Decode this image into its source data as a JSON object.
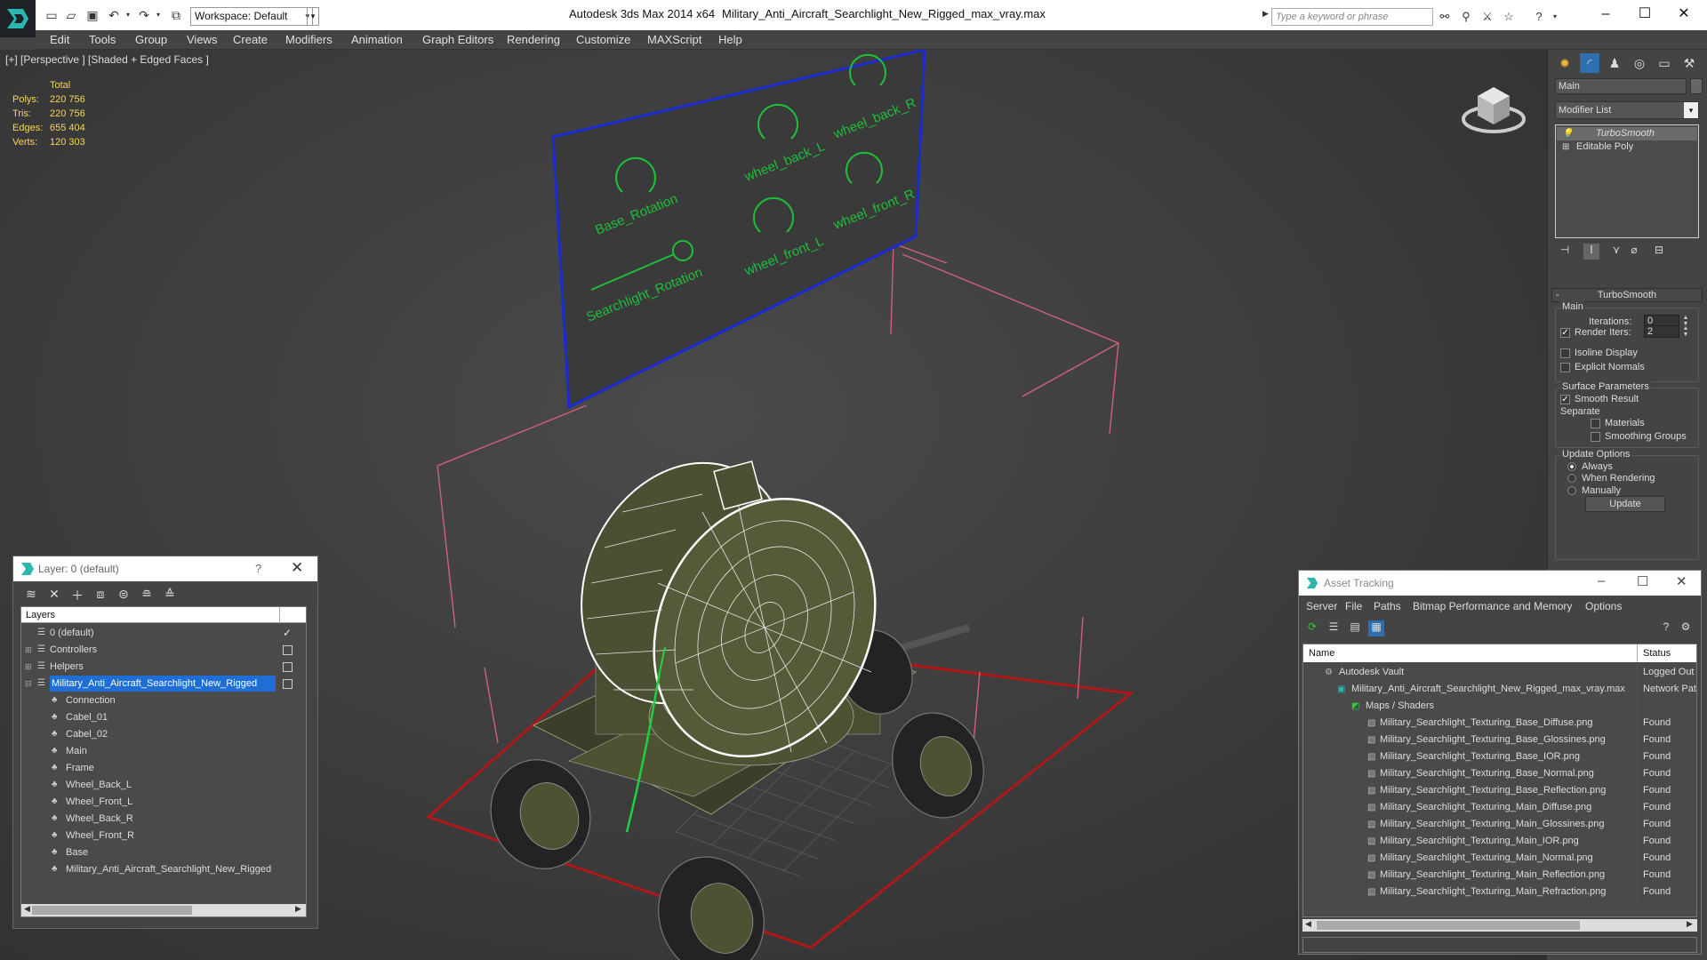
{
  "titlebar": {
    "workspace": "Workspace: Default",
    "app_title": "Autodesk 3ds Max  2014 x64",
    "doc_title": "Military_Anti_Aircraft_Searchlight_New_Rigged_max_vray.max",
    "search_placeholder": "Type a keyword or phrase"
  },
  "menu": [
    "Edit",
    "Tools",
    "Group",
    "Views",
    "Create",
    "Modifiers",
    "Animation",
    "Graph Editors",
    "Rendering",
    "Customize",
    "MAXScript",
    "Help"
  ],
  "viewport": {
    "label": "[+] [Perspective ] [Shaded + Edged Faces ]",
    "stats": {
      "total_label": "Total",
      "polys_label": "Polys:",
      "polys": "220 756",
      "tris_label": "Tris:",
      "tris": "220 756",
      "edges_label": "Edges:",
      "edges": "655 404",
      "verts_label": "Verts:",
      "verts": "120 303"
    },
    "board_labels": [
      "Base_Rotation",
      "wheel_back_L",
      "wheel_back_R",
      "wheel_front_L",
      "wheel_front_R",
      "Searchlight_Rotation"
    ]
  },
  "command_panel": {
    "object_name": "Main",
    "modifier_list": "Modifier List",
    "stack": [
      "TurboSmooth",
      "Editable Poly"
    ],
    "rollout_title": "TurboSmooth",
    "main_group": "Main",
    "iterations_label": "Iterations:",
    "iterations": "0",
    "render_iters_label": "Render Iters:",
    "render_iters": "2",
    "isoline": "Isoline Display",
    "explicit_normals": "Explicit Normals",
    "surface_group": "Surface Parameters",
    "smooth_result": "Smooth Result",
    "separate": "Separate",
    "materials": "Materials",
    "smoothing_groups": "Smoothing Groups",
    "update_group": "Update Options",
    "always": "Always",
    "when_rendering": "When Rendering",
    "manually": "Manually",
    "update_btn": "Update"
  },
  "layer_window": {
    "title": "Layer: 0 (default)",
    "help": "?",
    "header": "Layers",
    "layers": [
      "0 (default)",
      "Controllers",
      "Helpers",
      "Military_Anti_Aircraft_Searchlight_New_Rigged"
    ],
    "children": [
      "Connection",
      "Cabel_01",
      "Cabel_02",
      "Main",
      "Frame",
      "Wheel_Back_L",
      "Wheel_Front_L",
      "Wheel_Back_R",
      "Wheel_Front_R",
      "Base",
      "Military_Anti_Aircraft_Searchlight_New_Rigged"
    ]
  },
  "asset_window": {
    "title": "Asset Tracking",
    "menu": [
      "Server",
      "File",
      "Paths",
      "Bitmap Performance and Memory",
      "Options"
    ],
    "col_name": "Name",
    "col_status": "Status",
    "vault": {
      "name": "Autodesk Vault",
      "status": "Logged Out"
    },
    "file": {
      "name": "Military_Anti_Aircraft_Searchlight_New_Rigged_max_vray.max",
      "status": "Network Path"
    },
    "maps": "Maps / Shaders",
    "assets": [
      {
        "name": "Military_Searchlight_Texturing_Base_Diffuse.png",
        "status": "Found"
      },
      {
        "name": "Military_Searchlight_Texturing_Base_Glossines.png",
        "status": "Found"
      },
      {
        "name": "Military_Searchlight_Texturing_Base_IOR.png",
        "status": "Found"
      },
      {
        "name": "Military_Searchlight_Texturing_Base_Normal.png",
        "status": "Found"
      },
      {
        "name": "Military_Searchlight_Texturing_Base_Reflection.png",
        "status": "Found"
      },
      {
        "name": "Military_Searchlight_Texturing_Main_Diffuse.png",
        "status": "Found"
      },
      {
        "name": "Military_Searchlight_Texturing_Main_Glossines.png",
        "status": "Found"
      },
      {
        "name": "Military_Searchlight_Texturing_Main_IOR.png",
        "status": "Found"
      },
      {
        "name": "Military_Searchlight_Texturing_Main_Normal.png",
        "status": "Found"
      },
      {
        "name": "Military_Searchlight_Texturing_Main_Reflection.png",
        "status": "Found"
      },
      {
        "name": "Military_Searchlight_Texturing_Main_Refraction.png",
        "status": "Found"
      }
    ]
  }
}
